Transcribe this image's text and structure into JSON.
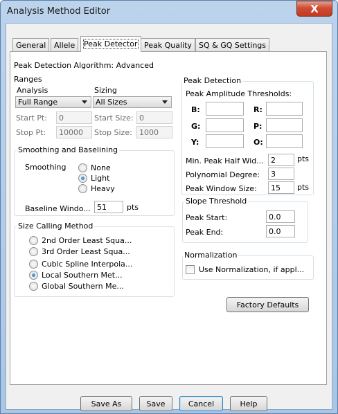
{
  "window": {
    "title": "Analysis Method Editor",
    "close_glyph": "X"
  },
  "tabs": [
    {
      "label": "General"
    },
    {
      "label": "Allele"
    },
    {
      "label": "Peak Detector"
    },
    {
      "label": "Peak Quality"
    },
    {
      "label": "SQ & GQ Settings"
    }
  ],
  "algorithm": {
    "label": "Peak Detection Algorithm:",
    "value": "Advanced"
  },
  "ranges": {
    "title": "Ranges",
    "analysis_label": "Analysis",
    "analysis_value": "Full Range",
    "sizing_label": "Sizing",
    "sizing_value": "All Sizes",
    "start_pt_label": "Start Pt:",
    "start_pt_value": "0",
    "stop_pt_label": "Stop Pt:",
    "stop_pt_value": "10000",
    "start_size_label": "Start Size:",
    "start_size_value": "0",
    "stop_size_label": "Stop Size:",
    "stop_size_value": "1000"
  },
  "smoothing": {
    "title": "Smoothing and Baselining",
    "smoothing_label": "Smoothing",
    "options": [
      "None",
      "Light",
      "Heavy"
    ],
    "selected": "Light",
    "baseline_label": "Baseline Windo...",
    "baseline_value": "51",
    "baseline_unit": "pts"
  },
  "size_calling": {
    "title": "Size Calling Method",
    "options": [
      "2nd Order Least Squa...",
      "3rd Order Least Squa...",
      "Cubic Spline Interpola...",
      "Local Southern Met...",
      "Global Southern Me..."
    ],
    "selected": "Local Southern Met..."
  },
  "peak_detection": {
    "title": "Peak Detection",
    "thresholds_label": "Peak Amplitude Thresholds:",
    "b_label": "B:",
    "r_label": "R:",
    "g_label": "G:",
    "p_label": "P:",
    "y_label": "Y:",
    "o_label": "O:",
    "b_value": "",
    "r_value": "",
    "g_value": "",
    "p_value": "",
    "y_value": "",
    "o_value": "",
    "min_half_label": "Min. Peak Half Wid...",
    "min_half_value": "2",
    "min_half_unit": "pts",
    "poly_label": "Polynomial Degree:",
    "poly_value": "3",
    "window_label": "Peak Window Size:",
    "window_value": "15",
    "window_unit": "pts"
  },
  "slope": {
    "title": "Slope Threshold",
    "start_label": "Peak Start:",
    "start_value": "0.0",
    "end_label": "Peak End:",
    "end_value": "0.0"
  },
  "normalization": {
    "title": "Normalization",
    "checkbox_label": "Use Normalization, if appl...",
    "checked": false
  },
  "buttons": {
    "factory_defaults": "Factory Defaults",
    "save_as": "Save As",
    "save": "Save",
    "cancel": "Cancel",
    "help": "Help"
  }
}
